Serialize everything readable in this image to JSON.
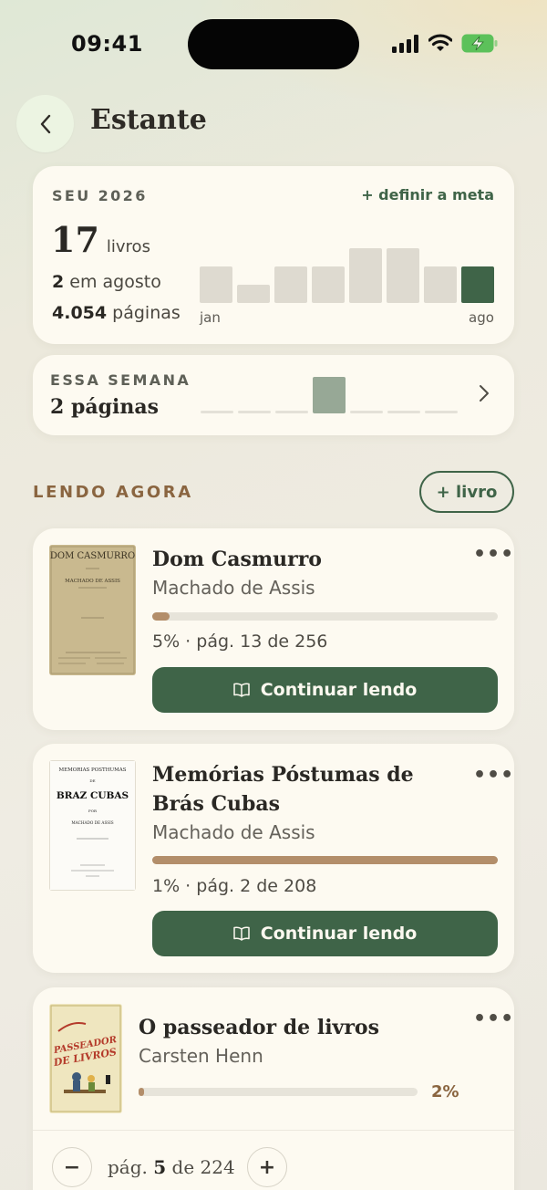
{
  "status_bar": {
    "time": "09:41"
  },
  "header": {
    "title": "Estante"
  },
  "year_summary": {
    "label": "SEU 2026",
    "goal_link": "+ definir a meta",
    "books_count": "17",
    "books_unit": "livros",
    "month_count": "2",
    "month_text": "em agosto",
    "pages_count": "4.054",
    "pages_text": "páginas",
    "axis_start": "jan",
    "axis_end": "ago",
    "monthly_books": [
      2,
      1,
      2,
      2,
      3,
      3,
      2,
      2
    ],
    "active_month_index": 7
  },
  "week_summary": {
    "label": "ESSA SEMANA",
    "value": "2 páginas",
    "daily_pages": [
      0,
      0,
      0,
      2,
      0,
      0,
      0
    ]
  },
  "reading_now": {
    "label": "LENDO AGORA",
    "add_button": "+ livro"
  },
  "books": [
    {
      "title": "Dom Casmurro",
      "author": "Machado de Assis",
      "progress": 0.05,
      "progress_text": "5% · pág. 13 de 256",
      "button": "Continuar lendo",
      "cover": {
        "title": "DOM CASMURRO",
        "author": "MACHADO DE ASSIS"
      }
    },
    {
      "title": "Memórias Póstumas de Brás Cubas",
      "author": "Machado de Assis",
      "progress": 1.0,
      "progress_text": "1% · pág. 2 de 208",
      "button": "Continuar lendo",
      "cover": {
        "line1": "MEMORIAS POSTHUMAS",
        "title": "BRAZ CUBAS",
        "author": "MACHADO DE ASSIS"
      }
    },
    {
      "title": "O passeador de livros",
      "author": "Carsten Henn",
      "progress": 0.02,
      "percent": "2%",
      "page_label": "pág.",
      "page_current": "5",
      "page_of": "de 224",
      "cover": {
        "title": "O PASSEADOR DE LIVROS"
      }
    }
  ],
  "colors": {
    "accent": "#3f6448",
    "brand_brown": "#8a6540",
    "card": "#fdfaf1",
    "progress": "#b38e6a"
  }
}
